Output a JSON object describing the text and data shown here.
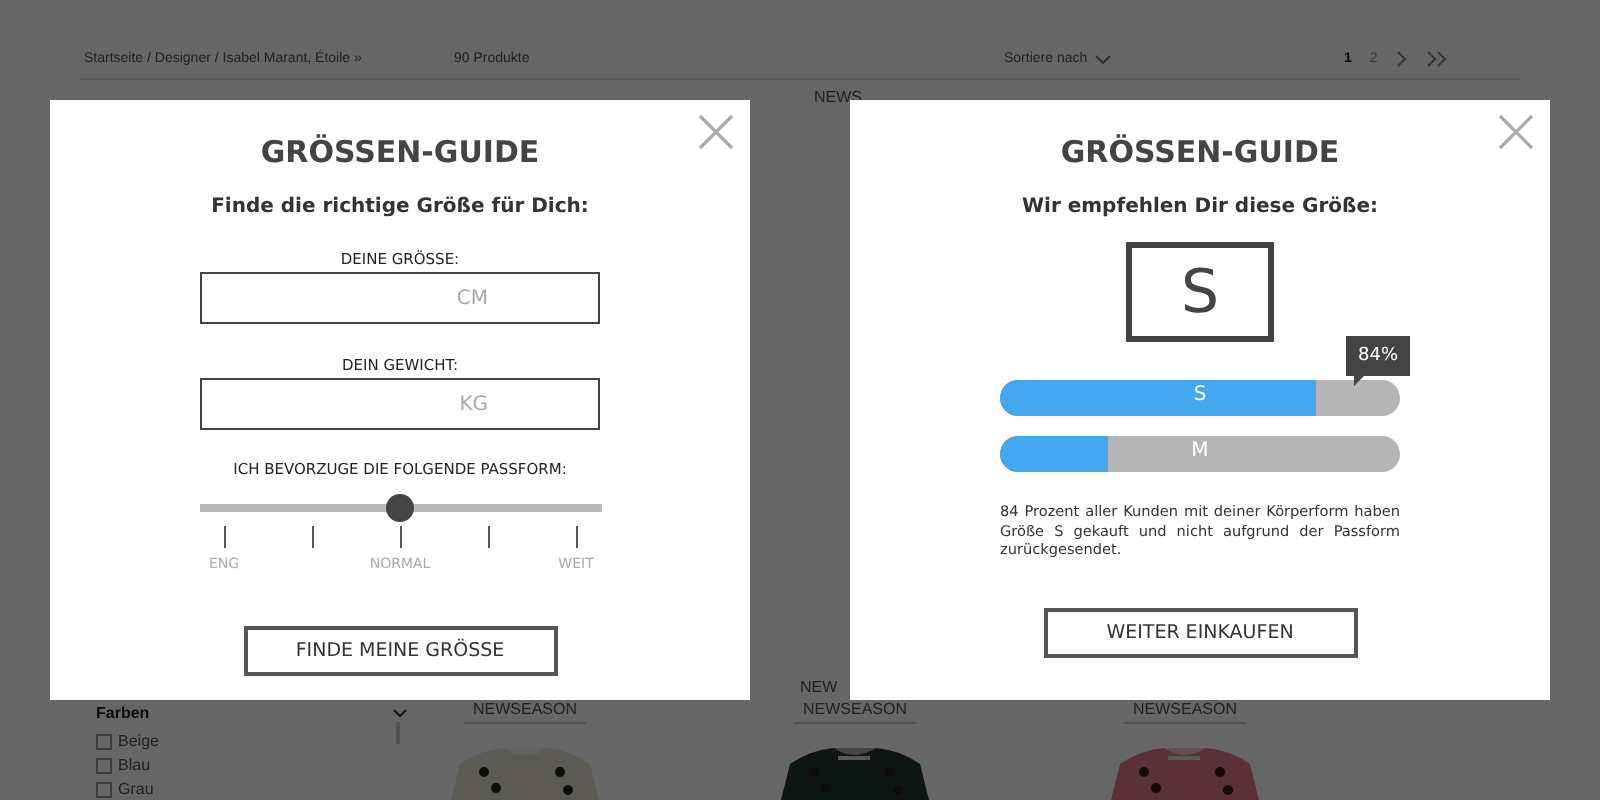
{
  "page": {
    "breadcrumb": "Startseite / Designer / Isabel Marant, Étoile »",
    "product_count": "90 Produkte",
    "sort_label": "Sortiere nach",
    "pagination": [
      {
        "label": "1",
        "selected": true
      },
      {
        "label": "2",
        "selected": false
      }
    ],
    "filter": {
      "title": "Farben",
      "options": [
        {
          "label": "Beige",
          "checked": false
        },
        {
          "label": "Blau",
          "checked": false
        },
        {
          "label": "Grau",
          "checked": false
        }
      ]
    },
    "top_badge": "NEWS",
    "middle_badge": "NEW",
    "products": [
      {
        "badge": "NEWSEASON"
      },
      {
        "badge": "NEWSEASON"
      },
      {
        "badge": "NEWSEASON"
      }
    ]
  },
  "form_dialog": {
    "title": "GRÖSSEN-GUIDE",
    "subtitle": "Finde die richtige Größe für Dich:",
    "fields": [
      {
        "label": "DEINE GRÖSSE:",
        "placeholder": "CM"
      },
      {
        "label": "DEIN GEWICHT:",
        "placeholder": "KG"
      }
    ],
    "fit": {
      "label": "ICH BEVORZUGE DIE FOLGENDE PASSFORM:",
      "level": 0.5,
      "tick_labels": [
        "ENG",
        "NORMAL",
        "WEIT"
      ]
    },
    "button": "FINDE MEINE GRÖSSE"
  },
  "result_dialog": {
    "title": "GRÖSSEN-GUIDE",
    "subtitle": "Wir empfehlen Dir diese Größe:",
    "size": "S",
    "bars": [
      {
        "label": "S",
        "level": 0.79,
        "tooltip": "84%"
      },
      {
        "label": "M",
        "level": 0.27
      }
    ],
    "note": "84 Prozent aller Kunden mit deiner Körperform haben Größe S gekauft und nicht aufgrund der Passform zurückgesendet.",
    "button": "WEITER EINKAUFEN"
  }
}
